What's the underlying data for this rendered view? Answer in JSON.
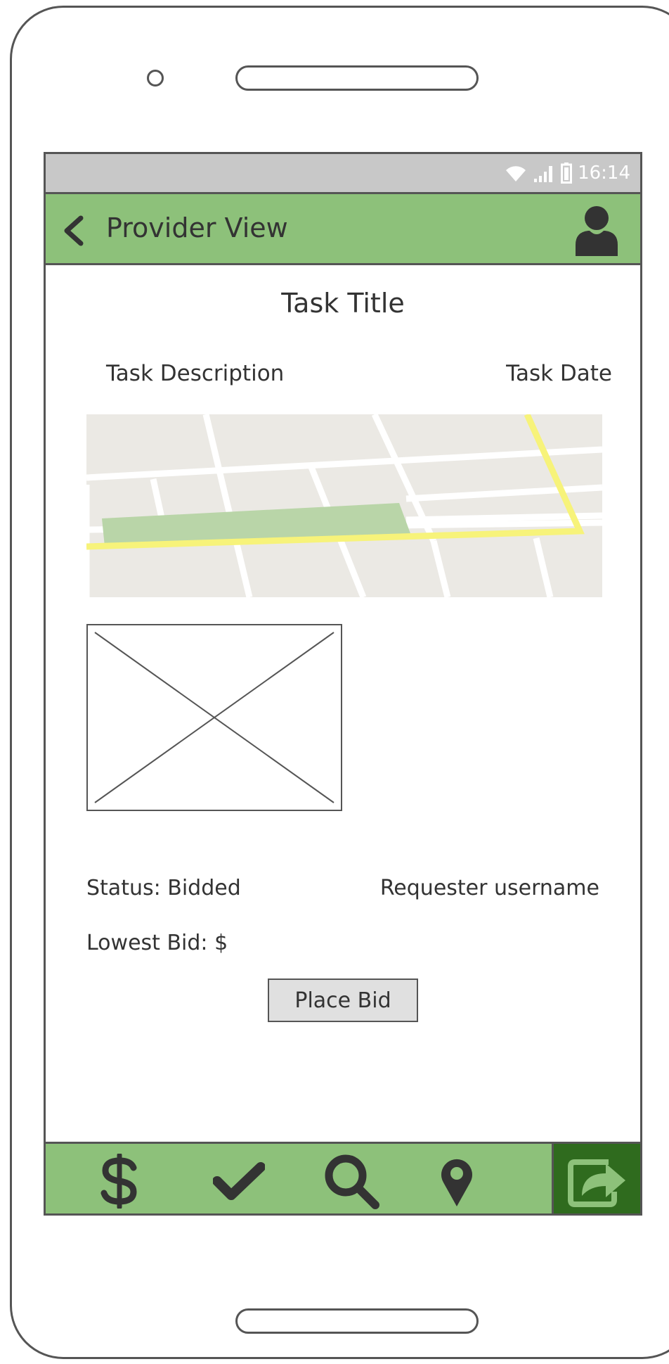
{
  "status_bar": {
    "time": "16:14",
    "icons": [
      "wifi-icon",
      "signal-icon",
      "battery-icon"
    ]
  },
  "app_bar": {
    "title": "Provider View",
    "back_icon": "chevron-left-icon",
    "profile_icon": "user-icon"
  },
  "task": {
    "title": "Task Title",
    "description": "Task Description",
    "date": "Task Date",
    "status": "Status: Bidded",
    "requester": "Requester username",
    "lowest_bid": "Lowest Bid: $",
    "place_bid_label": "Place Bid"
  },
  "bottom_nav": {
    "items": [
      {
        "name": "payments",
        "icon": "dollar-icon"
      },
      {
        "name": "completed",
        "icon": "checkmark-icon"
      },
      {
        "name": "search",
        "icon": "search-icon"
      },
      {
        "name": "location",
        "icon": "map-pin-icon"
      },
      {
        "name": "share",
        "icon": "share-icon",
        "active": true
      }
    ]
  },
  "colors": {
    "accent_green": "#8dc17a",
    "active_green": "#2f6b1e",
    "status_bar_gray": "#c8c8c8",
    "button_gray": "#e0e0e0"
  }
}
